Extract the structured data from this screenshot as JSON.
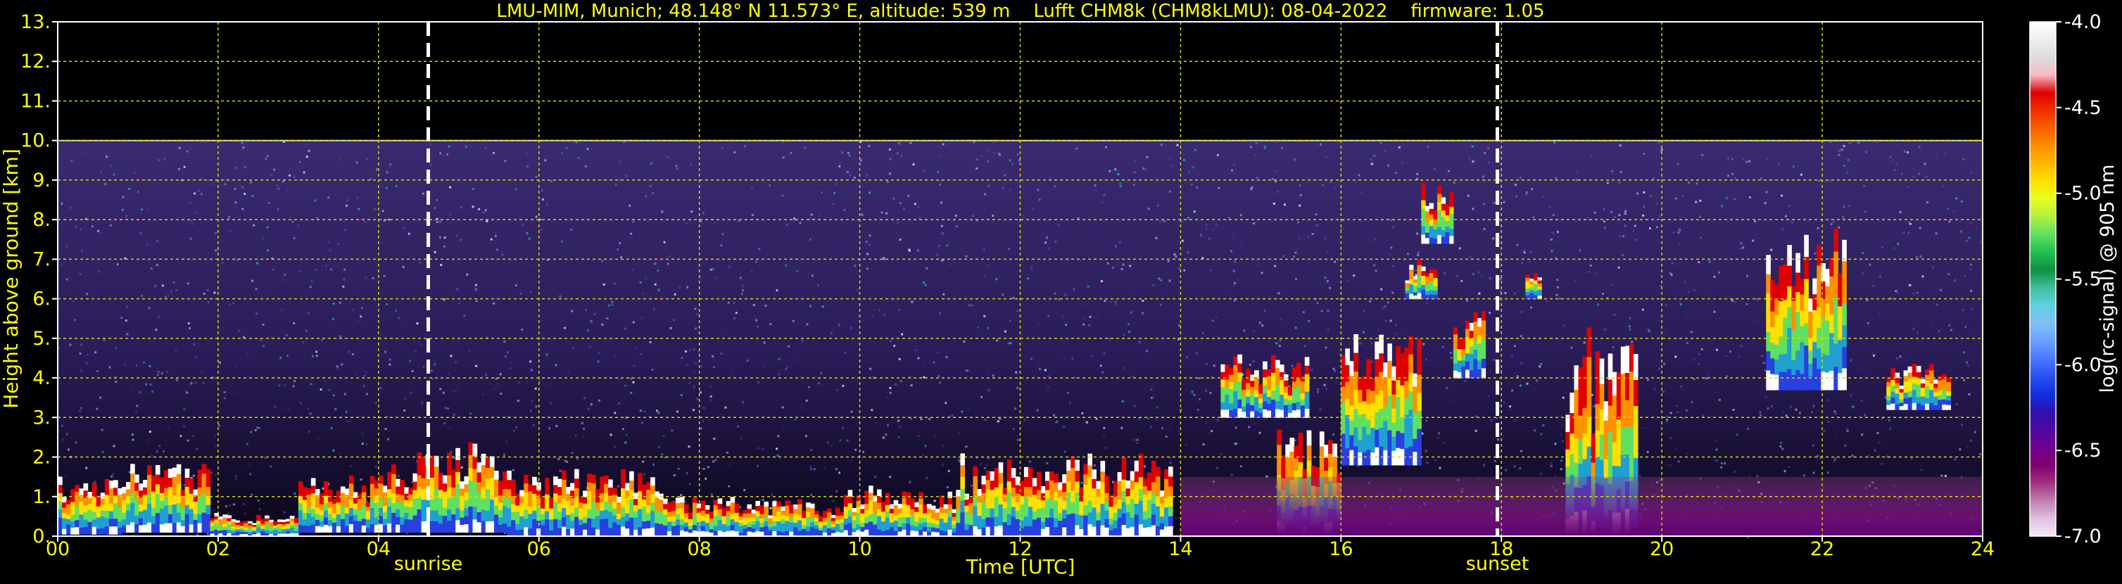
{
  "chart_data": {
    "type": "heatmap",
    "title": "LMU-MIM, Munich; 48.148° N 11.573° E, altitude: 539 m    Lufft CHM8k (CHM8kLMU): 08-04-2022    firmware: 1.05",
    "xlabel": "Time [UTC]",
    "ylabel": "Height above ground [km]",
    "xlim": [
      0,
      24
    ],
    "ylim": [
      0,
      13
    ],
    "x_ticks": [
      "00",
      "02",
      "04",
      "06",
      "08",
      "10",
      "12",
      "14",
      "16",
      "18",
      "20",
      "22",
      "24"
    ],
    "y_ticks": [
      "0.",
      "1.",
      "2.",
      "3.",
      "4.",
      "5.",
      "6.",
      "7.",
      "8.",
      "9.",
      "10.",
      "11.",
      "12.",
      "13."
    ],
    "grid": true,
    "data_ceiling_km": 10,
    "events": [
      {
        "label": "sunrise",
        "time": 4.62
      },
      {
        "label": "sunset",
        "time": 17.95
      }
    ],
    "colorbar": {
      "label": "log(rc-signal) @ 905 nm",
      "range": [
        -7.0,
        -4.0
      ],
      "ticks": [
        "-4.0",
        "-4.5",
        "-5.0",
        "-5.5",
        "-6.0",
        "-6.5",
        "-7.0"
      ],
      "colors": [
        "#ffffff",
        "#eeeeee",
        "#dddddd",
        "#f6b9c6",
        "#e00000",
        "#f03000",
        "#f86000",
        "#ff9000",
        "#ffb800",
        "#ffe000",
        "#e8ff20",
        "#b0f040",
        "#60e060",
        "#20c050",
        "#109040",
        "#40c0a0",
        "#60d0e0",
        "#80c0f8",
        "#6aa0ff",
        "#4a78ff",
        "#2850f0",
        "#1030e0",
        "#3010b0",
        "#5008a0",
        "#700090",
        "#800070",
        "#a03080",
        "#c080b0",
        "#e0c0e0",
        "#f4e8f4"
      ]
    },
    "layers": [
      {
        "kind": "cloud",
        "start": 0.0,
        "end": 0.8,
        "base": 0.05,
        "top": 1.6
      },
      {
        "kind": "cloud",
        "start": 0.8,
        "end": 1.9,
        "base": 0.1,
        "top": 1.9
      },
      {
        "kind": "cloud",
        "start": 1.9,
        "end": 3.0,
        "base": 0.0,
        "top": 0.6
      },
      {
        "kind": "cloud",
        "start": 3.0,
        "end": 4.0,
        "base": 0.1,
        "top": 1.6
      },
      {
        "kind": "cloud",
        "start": 4.0,
        "end": 5.6,
        "base": 0.1,
        "top": 2.4
      },
      {
        "kind": "cloud",
        "start": 5.6,
        "end": 7.6,
        "base": 0.0,
        "top": 1.7
      },
      {
        "kind": "cloud",
        "start": 7.6,
        "end": 9.8,
        "base": 0.0,
        "top": 1.0
      },
      {
        "kind": "cloud",
        "start": 9.8,
        "end": 11.2,
        "base": 0.0,
        "top": 1.3
      },
      {
        "kind": "cloud",
        "start": 11.2,
        "end": 13.9,
        "base": 0.0,
        "top": 2.1
      },
      {
        "kind": "cloud",
        "start": 14.5,
        "end": 15.6,
        "base": 3.0,
        "top": 4.6
      },
      {
        "kind": "cloud",
        "start": 15.2,
        "end": 16.0,
        "base": 0.0,
        "top": 2.7
      },
      {
        "kind": "cloud",
        "start": 16.0,
        "end": 17.0,
        "base": 1.8,
        "top": 5.2
      },
      {
        "kind": "cloud",
        "start": 16.8,
        "end": 17.2,
        "base": 6.0,
        "top": 7.0
      },
      {
        "kind": "cloud",
        "start": 17.0,
        "end": 17.4,
        "base": 7.4,
        "top": 9.0
      },
      {
        "kind": "cloud",
        "start": 17.4,
        "end": 17.8,
        "base": 4.0,
        "top": 5.8
      },
      {
        "kind": "cloud",
        "start": 18.8,
        "end": 19.7,
        "base": 0.0,
        "top": 5.5
      },
      {
        "kind": "cloud",
        "start": 18.3,
        "end": 18.5,
        "base": 6.0,
        "top": 6.7
      },
      {
        "kind": "cloud",
        "start": 21.3,
        "end": 22.3,
        "base": 3.7,
        "top": 7.8
      },
      {
        "kind": "cloud",
        "start": 22.8,
        "end": 23.6,
        "base": 3.2,
        "top": 4.4
      },
      {
        "kind": "aerosol",
        "start": 14.0,
        "end": 24.0,
        "base": 0.0,
        "top": 1.5
      }
    ]
  }
}
